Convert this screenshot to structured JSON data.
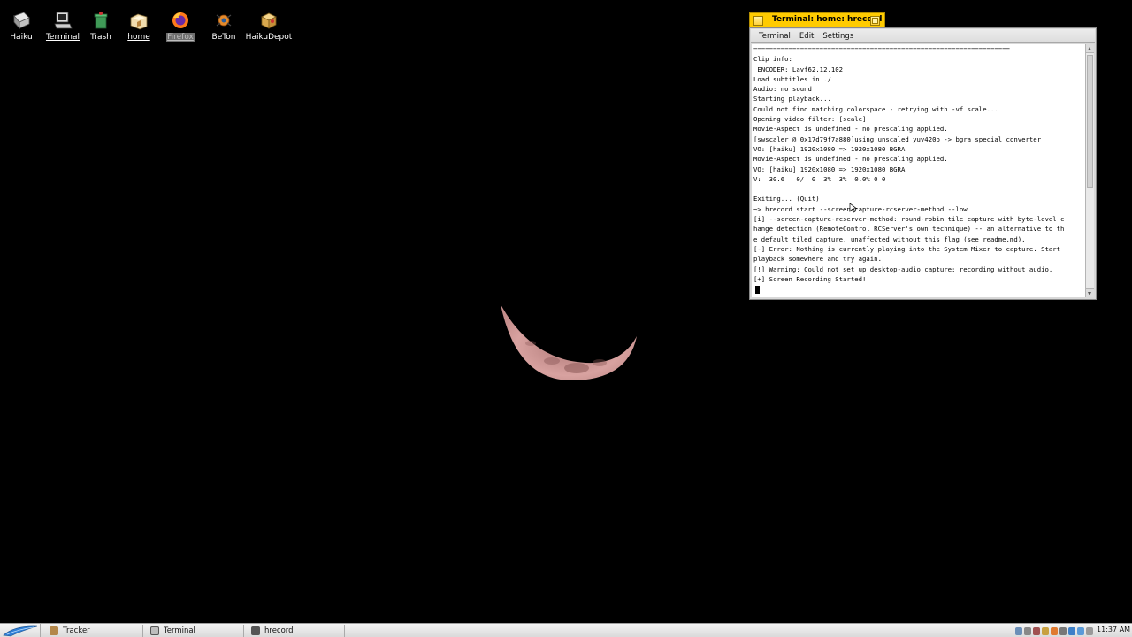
{
  "desktop": {
    "icons": [
      {
        "label": "Haiku"
      },
      {
        "label": "Terminal"
      },
      {
        "label": "Trash"
      },
      {
        "label": "home"
      },
      {
        "label": "Firefox"
      },
      {
        "label": "BeTon"
      },
      {
        "label": "HaikuDepot"
      }
    ]
  },
  "terminal_window": {
    "title": "Terminal: home: hrecord",
    "menu": [
      "Terminal",
      "Edit",
      "Settings"
    ],
    "lines": [
      "==================================================================",
      "Clip info:",
      " ENCODER: Lavf62.12.102",
      "Load subtitles in ./",
      "Audio: no sound",
      "Starting playback...",
      "Could not find matching colorspace - retrying with -vf scale...",
      "Opening video filter: [scale]",
      "Movie-Aspect is undefined - no prescaling applied.",
      "[swscaler @ 0x17d79f7a880]using unscaled yuv420p -> bgra special converter",
      "VO: [haiku] 1920x1080 => 1920x1080 BGRA",
      "Movie-Aspect is undefined - no prescaling applied.",
      "VO: [haiku] 1920x1080 => 1920x1080 BGRA",
      "V:  30.6   0/  0  3%  3%  0.0% 0 0",
      "",
      "Exiting... (Quit)",
      "~> hrecord start --screen-capture-rcserver-method --low",
      "[i] --screen-capture-rcserver-method: round-robin tile capture with byte-level c",
      "hange detection (RemoteControl RCServer's own technique) -- an alternative to th",
      "e default tiled capture, unaffected without this flag (see readme.md).",
      "[-] Error: Nothing is currently playing into the System Mixer to capture. Start",
      "playback somewhere and try again.",
      "[!] Warning: Could not set up desktop-audio capture; recording without audio.",
      "[+] Screen Recording Started!"
    ]
  },
  "taskbar": {
    "tasks": [
      {
        "label": "Tracker",
        "icon": "tracker-icon"
      },
      {
        "label": "Terminal",
        "icon": "terminal-icon"
      },
      {
        "label": "hrecord",
        "icon": "hrecord-icon"
      }
    ],
    "clock": "11:37 AM"
  },
  "colors": {
    "desktop_bg": "#000000",
    "window_tab": "#ffcb00"
  }
}
